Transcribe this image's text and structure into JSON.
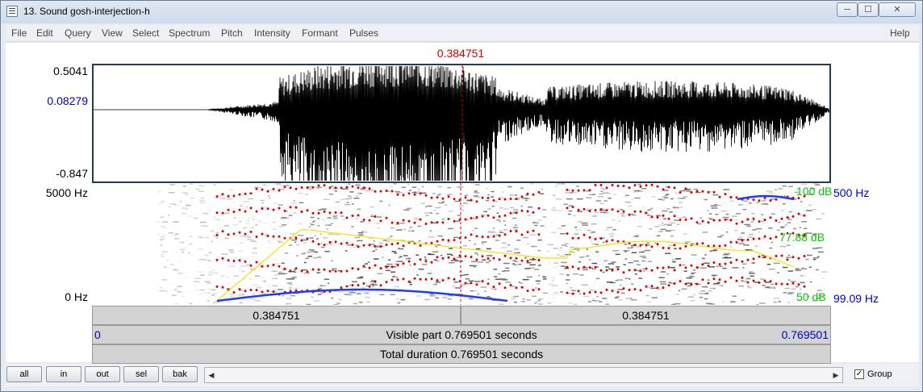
{
  "window": {
    "title": "13. Sound gosh-interjection-h",
    "minimize_glyph": "─",
    "maximize_glyph": "☐",
    "close_glyph": "✕"
  },
  "menu": {
    "items": [
      "File",
      "Edit",
      "Query",
      "View",
      "Select",
      "Spectrum",
      "Pitch",
      "Intensity",
      "Formant",
      "Pulses"
    ],
    "help": "Help"
  },
  "cursor": {
    "time_label": "0.384751",
    "color": "#d00000"
  },
  "waveform": {
    "max_label": "0.5041",
    "cursor_value_label": "0.08279",
    "min_label": "-0.847"
  },
  "spectrogram": {
    "top_freq_label": "5000 Hz",
    "bottom_freq_label": "0 Hz",
    "intensity_top_label": "100 dB",
    "intensity_mid_label": "77.88 dB",
    "intensity_bottom_label": "50 dB",
    "pitch_top_label": "500 Hz",
    "pitch_bottom_label": "99.09 Hz",
    "colors": {
      "formant": "#e00000",
      "pitch": "#1e3cff",
      "intensity": "#e8e800",
      "label_green": "#00cc00",
      "label_blue": "#0000c8"
    }
  },
  "time_bars": {
    "left_segment": "0.384751",
    "right_segment": "0.384751",
    "visible_start": "0",
    "visible_label": "Visible part 0.769501 seconds",
    "visible_end": "0.769501",
    "total_label": "Total duration 0.769501 seconds"
  },
  "bottom": {
    "buttons": [
      "all",
      "in",
      "out",
      "sel",
      "bak"
    ],
    "scroll_left": "◀",
    "scroll_right": "▶",
    "group_label": "Group",
    "group_checked_glyph": "✓"
  }
}
